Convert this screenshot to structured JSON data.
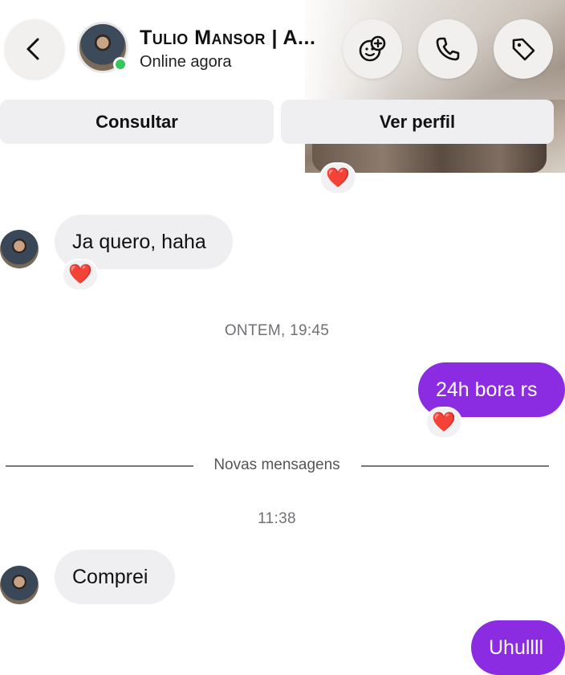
{
  "header": {
    "contact_name": "Tulio Mansor | A...",
    "status": "Online agora"
  },
  "actions": {
    "consult_label": "Consultar",
    "profile_label": "Ver perfil"
  },
  "icons": {
    "back": "chevron-left-icon",
    "sticker": "sticker-add-icon",
    "call": "phone-icon",
    "tag": "tag-icon",
    "reaction": "heart-icon"
  },
  "colors": {
    "outgoing_bubble": "#8b2be2",
    "incoming_bubble": "#efeff1",
    "online": "#35c759",
    "heart": "#e0202c"
  },
  "messages": [
    {
      "from": "contact",
      "text": "Ja quero, haha",
      "reaction": "❤️"
    },
    {
      "separator": "ONTEM, 19:45"
    },
    {
      "from": "me",
      "text": "24h bora rs",
      "reaction": "❤️"
    },
    {
      "new_divider": "Novas mensagens"
    },
    {
      "separator": "11:38"
    },
    {
      "from": "contact",
      "text": "Comprei"
    },
    {
      "from": "me",
      "text": "Uhullll"
    }
  ],
  "top_reaction": "❤️"
}
